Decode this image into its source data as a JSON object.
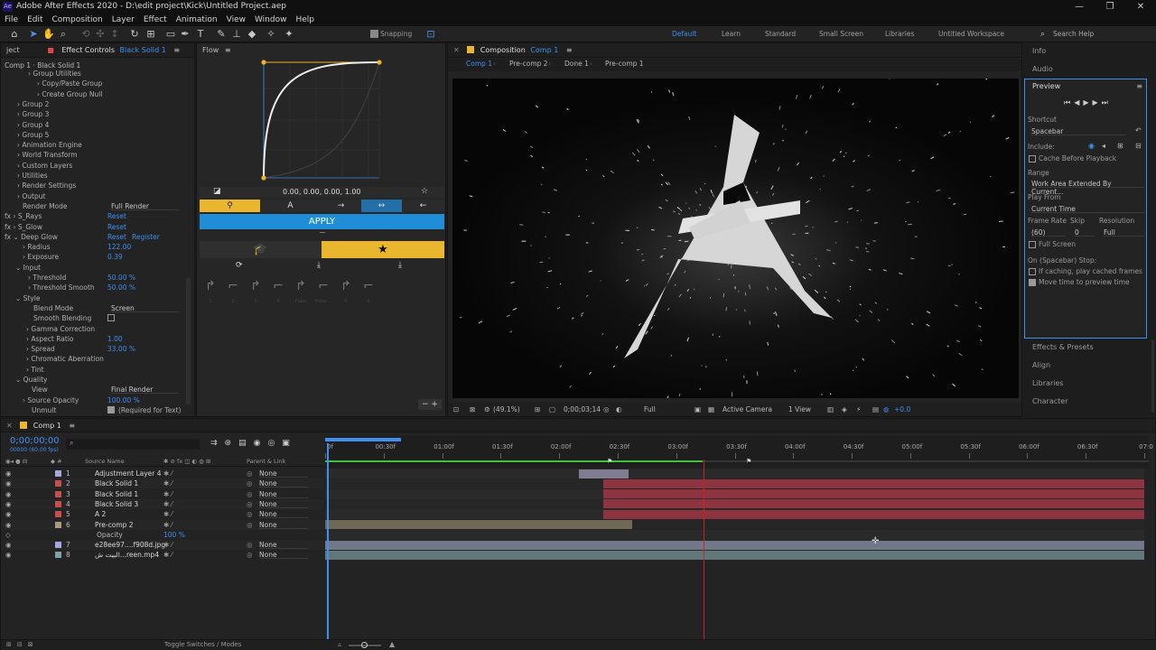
{
  "app": {
    "logo": "Ae",
    "title": "Adobe After Effects 2020 - D:\\edit project\\Kick\\Untitled Project.aep",
    "window_controls": [
      "—",
      "❐",
      "✕"
    ]
  },
  "menu": [
    "File",
    "Edit",
    "Composition",
    "Layer",
    "Effect",
    "Animation",
    "View",
    "Window",
    "Help"
  ],
  "toolbar": {
    "snapping": "Snapping",
    "workspaces": [
      "Default",
      "Learn",
      "Standard",
      "Small Screen",
      "Libraries",
      "Untitled Workspace"
    ],
    "search_placeholder": "Search Help"
  },
  "effect_controls": {
    "project_tab": "ject",
    "tab_label": "Effect Controls",
    "tab_layer": "Black Solid 1",
    "breadcrumb": "Comp 1 · Black Solid 1",
    "rows": [
      {
        "label": "› Group Utilities",
        "indent": 30
      },
      {
        "label": "› Copy/Paste Group",
        "indent": 40
      },
      {
        "label": "› Create Group Null",
        "indent": 40
      },
      {
        "label": "› Group 2",
        "indent": 18
      },
      {
        "label": "› Group 3",
        "indent": 18
      },
      {
        "label": "› Group 4",
        "indent": 18
      },
      {
        "label": "› Group 5",
        "indent": 18
      },
      {
        "label": "› Animation Engine",
        "indent": 18
      },
      {
        "label": "› World Transform",
        "indent": 18
      },
      {
        "label": "› Custom Layers",
        "indent": 18
      },
      {
        "label": "› Utilities",
        "indent": 18
      },
      {
        "label": "› Render Settings",
        "indent": 18
      },
      {
        "label": "› Output",
        "indent": 18
      },
      {
        "label": "Render Mode",
        "indent": 24,
        "value": "Full Render",
        "type": "dropdown"
      },
      {
        "label": "fx  ›  S_Rays",
        "indent": 4,
        "value": "Reset",
        "type": "link"
      },
      {
        "label": "fx  ›  S_Glow",
        "indent": 4,
        "value": "Reset",
        "type": "link"
      },
      {
        "label": "fx  ⌄  Deep Glow",
        "indent": 4,
        "value": "Reset",
        "value2": "Register",
        "type": "link2"
      },
      {
        "label": "›  Radius",
        "indent": 24,
        "value": "122.00",
        "type": "num"
      },
      {
        "label": "›  Exposure",
        "indent": 24,
        "value": "0.39",
        "type": "num"
      },
      {
        "label": "⌄ Input",
        "indent": 16
      },
      {
        "label": "›  Threshold",
        "indent": 30,
        "value": "50.00 %",
        "type": "num"
      },
      {
        "label": "›  Threshold Smooth",
        "indent": 30,
        "value": "50.00 %",
        "type": "num"
      },
      {
        "label": "⌄ Style",
        "indent": 16
      },
      {
        "label": "Blend Mode",
        "indent": 36,
        "value": "Screen",
        "type": "dropdown"
      },
      {
        "label": "Smooth Blending",
        "indent": 36,
        "type": "check"
      },
      {
        "label": "› Gamma Correction",
        "indent": 28
      },
      {
        "label": "›  Aspect Ratio",
        "indent": 28,
        "value": "1.00",
        "type": "num"
      },
      {
        "label": "›  Spread",
        "indent": 28,
        "value": "33.00 %",
        "type": "num"
      },
      {
        "label": "› Chromatic Aberration",
        "indent": 28
      },
      {
        "label": "› Tint",
        "indent": 28
      },
      {
        "label": "⌄ Quality",
        "indent": 16
      },
      {
        "label": "View",
        "indent": 34,
        "value": "Final Render",
        "type": "dropdown"
      },
      {
        "label": "›  Source Opacity",
        "indent": 24,
        "value": "100.00 %",
        "type": "num"
      },
      {
        "label": "Unmult",
        "indent": 34,
        "value": "(Required for Text)",
        "type": "checktext"
      }
    ]
  },
  "flow": {
    "tab": "Flow",
    "curve_value": "0.00, 0.00, 0.00, 1.00",
    "apply_label": "APPLY",
    "preset_labels": [
      "1",
      "2",
      "3",
      "4",
      "Fake",
      "Fake...",
      "5",
      "6"
    ]
  },
  "composition": {
    "tab_label": "Composition",
    "tab_name": "Comp 1",
    "breadcrumbs": [
      "Comp 1",
      "Pre-comp 2",
      "Done 1",
      "Pre-comp 1"
    ],
    "zoom": "(49.1%)",
    "timecode": "0;00;03;14",
    "resolution": "Full",
    "camera": "Active Camera",
    "views": "1 View",
    "exposure": "+0.0"
  },
  "right_panel": {
    "info": "Info",
    "audio": "Audio",
    "preview_title": "Preview",
    "shortcut_label": "Shortcut",
    "shortcut_value": "Spacebar",
    "include_label": "Include:",
    "cache_before": "Cache Before Playback",
    "range_label": "Range",
    "range_value": "Work Area Extended By Current...",
    "play_from_label": "Play From",
    "play_from_value": "Current Time",
    "frame_rate_label": "Frame Rate",
    "skip_label": "Skip",
    "resolution_label": "Resolution",
    "frame_rate_value": "(60)",
    "skip_value": "0",
    "resolution_value": "Full",
    "full_screen": "Full Screen",
    "on_stop": "On (Spacebar) Stop:",
    "if_caching": "If caching, play cached frames",
    "move_time": "Move time to preview time",
    "collapsed": [
      "Effects & Presets",
      "Align",
      "Libraries",
      "Character"
    ]
  },
  "timeline": {
    "tab": "Comp 1",
    "timecode": "0;00;00;00",
    "fps": "00000 (60.00 fps)",
    "col_source": "Source Name",
    "col_parent": "Parent & Link",
    "ruler": [
      "0f",
      "00:30f",
      "01:00f",
      "01:30f",
      "02:00f",
      "02:30f",
      "03:00f",
      "03:30f",
      "04:00f",
      "04:30f",
      "05:00f",
      "05:30f",
      "06:00f",
      "06:30f",
      "07:0"
    ],
    "layers": [
      {
        "num": "1",
        "name": "Adjustment Layer 4",
        "color": "#a7a7e0",
        "parent": "None",
        "start": 0.31,
        "end": 0.37,
        "bar": "#807d92"
      },
      {
        "num": "2",
        "name": "Black Solid 1",
        "color": "#c84e4e",
        "parent": "None",
        "start": 0.34,
        "end": 1.0,
        "bar": "#8e3441"
      },
      {
        "num": "3",
        "name": "Black Solid 1",
        "color": "#c84e4e",
        "parent": "None",
        "start": 0.34,
        "end": 1.0,
        "bar": "#8e3441"
      },
      {
        "num": "4",
        "name": "Black Solid 3",
        "color": "#c84e4e",
        "parent": "None",
        "start": 0.34,
        "end": 1.0,
        "bar": "#8e3441"
      },
      {
        "num": "5",
        "name": "A 2",
        "color": "#c84e4e",
        "parent": "None",
        "start": 0.34,
        "end": 1.0,
        "bar": "#8e3441"
      },
      {
        "num": "6",
        "name": "Pre-comp 2",
        "color": "#a89a7a",
        "parent": "None",
        "start": 0.0,
        "end": 0.375,
        "bar": "#6f6857"
      },
      {
        "num": "",
        "name": "Opacity",
        "color": "",
        "parent": "",
        "value": "100 %",
        "start": 0,
        "end": 0,
        "bar": ""
      },
      {
        "num": "7",
        "name": "e28ee97....f908d.jpg",
        "color": "#a7a7e0",
        "parent": "None",
        "start": 0.0,
        "end": 1.0,
        "bar": "#727888"
      },
      {
        "num": "8",
        "name": "البيت ش...reen.mp4",
        "color": "#7fa3a3",
        "parent": "None",
        "start": 0.0,
        "end": 1.0,
        "bar": "#62777a"
      }
    ],
    "footer": "Toggle Switches / Modes"
  }
}
